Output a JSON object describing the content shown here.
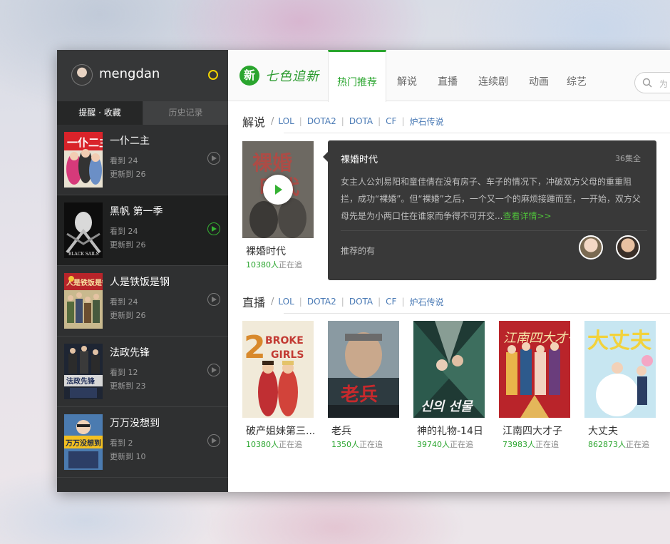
{
  "user": {
    "name": "mengdan"
  },
  "sidebar": {
    "tabs": [
      "提醒 · 收藏",
      "历史记录"
    ],
    "items": [
      {
        "title": "一仆二主",
        "seen": "看到 24",
        "updated": "更新到 26",
        "selected": false
      },
      {
        "title": "黑帆 第一季",
        "seen": "看到 24",
        "updated": "更新到 26",
        "selected": true
      },
      {
        "title": "人是铁饭是钢",
        "seen": "看到 24",
        "updated": "更新到 26",
        "selected": false
      },
      {
        "title": "法政先锋",
        "seen": "看到 12",
        "updated": "更新到 23",
        "selected": false
      },
      {
        "title": "万万没想到",
        "seen": "看到 2",
        "updated": "更新到 10",
        "selected": false
      }
    ]
  },
  "header": {
    "logo_badge": "新",
    "logo_text": "七色追新",
    "tabs": [
      "热门推荐",
      "解说",
      "直播",
      "连续剧",
      "动画",
      "综艺"
    ],
    "active_tab": "热门推荐",
    "search_placeholder": "为"
  },
  "sections": {
    "commentary": {
      "title": "解说",
      "links": [
        "LOL",
        "DOTA2",
        "DOTA",
        "CF",
        "炉石传说"
      ],
      "cards": [
        {
          "title": "裸婚时代",
          "count": "10380人",
          "suffix": "正在追"
        }
      ]
    },
    "live": {
      "title": "直播",
      "links": [
        "LOL",
        "DOTA2",
        "DOTA",
        "CF",
        "炉石传说"
      ],
      "cards": [
        {
          "title": "破产姐妹第三...",
          "count": "10380人",
          "suffix": "正在追"
        },
        {
          "title": "老兵",
          "count": "1350人",
          "suffix": "正在追"
        },
        {
          "title": "神的礼物-14日",
          "count": "39740人",
          "suffix": "正在追"
        },
        {
          "title": "江南四大才子",
          "count": "73983人",
          "suffix": "正在追"
        },
        {
          "title": "大丈夫",
          "count": "862873人",
          "suffix": "正在追"
        }
      ]
    }
  },
  "popup": {
    "title": "裸婚时代",
    "episodes": "36集全",
    "description": "女主人公刘易阳和童佳倩在没有房子、车子的情况下，冲破双方父母的重重阻拦，成功“裸婚”。但“裸婚”之后，一个又一个的麻烦接踵而至，一开始，双方父母先是为小两口住在谁家而争得不可开交...",
    "more": "查看详情>>",
    "recommended_label": "推荐的有"
  },
  "colors": {
    "accent": "#2aa52e",
    "status_dot": "#f3d400",
    "sidebar_bg": "#2f3031"
  }
}
